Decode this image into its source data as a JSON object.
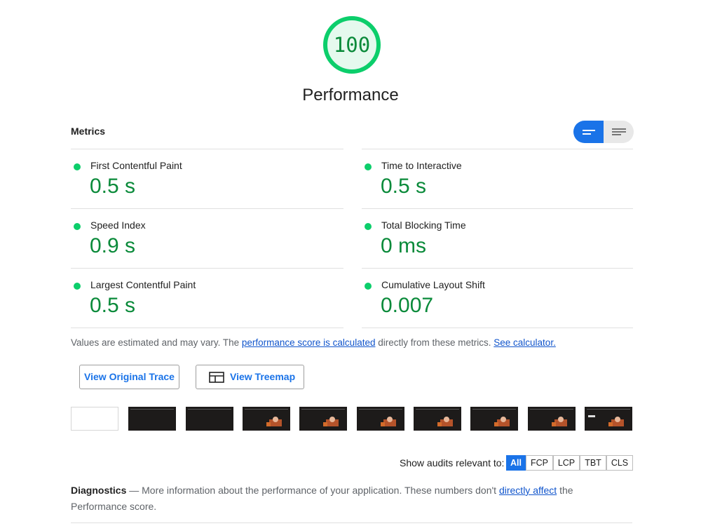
{
  "gauge": {
    "score": "100",
    "title": "Performance",
    "ring_color": "#0cce6b",
    "fill_color": "#e5f9ee",
    "score_fraction": 1.0
  },
  "metrics": {
    "heading": "Metrics",
    "view_toggle": {
      "icons": [
        "bars-view-icon",
        "list-view-icon"
      ],
      "selected": "bars-view-icon",
      "accent": "#1a73e8"
    },
    "items": [
      {
        "label": "First Contentful Paint",
        "value": "0.5 s",
        "status": "pass"
      },
      {
        "label": "Time to Interactive",
        "value": "0.5 s",
        "status": "pass"
      },
      {
        "label": "Speed Index",
        "value": "0.9 s",
        "status": "pass"
      },
      {
        "label": "Total Blocking Time",
        "value": "0 ms",
        "status": "pass"
      },
      {
        "label": "Largest Contentful Paint",
        "value": "0.5 s",
        "status": "pass"
      },
      {
        "label": "Cumulative Layout Shift",
        "value": "0.007",
        "status": "pass"
      }
    ],
    "pass_color": "#0cce6b",
    "value_color": "#0a8a3a"
  },
  "note": {
    "prefix": "Values are estimated and may vary. The ",
    "link1": "performance score is calculated",
    "middle": " directly from these metrics. ",
    "link2": "See calculator."
  },
  "buttons": {
    "trace": "View Original Trace",
    "treemap": "View Treemap",
    "treemap_icon": "treemap-icon"
  },
  "filmstrip": {
    "frame_count": 10
  },
  "audit_filter": {
    "label": "Show audits relevant to:",
    "options": [
      "All",
      "FCP",
      "LCP",
      "TBT",
      "CLS"
    ],
    "selected": "All"
  },
  "diagnostics": {
    "title": "Diagnostics",
    "dash": " — ",
    "text_before": "More information about the performance of your application. These numbers don't ",
    "link": "directly affect",
    "text_after": " the Performance score."
  }
}
